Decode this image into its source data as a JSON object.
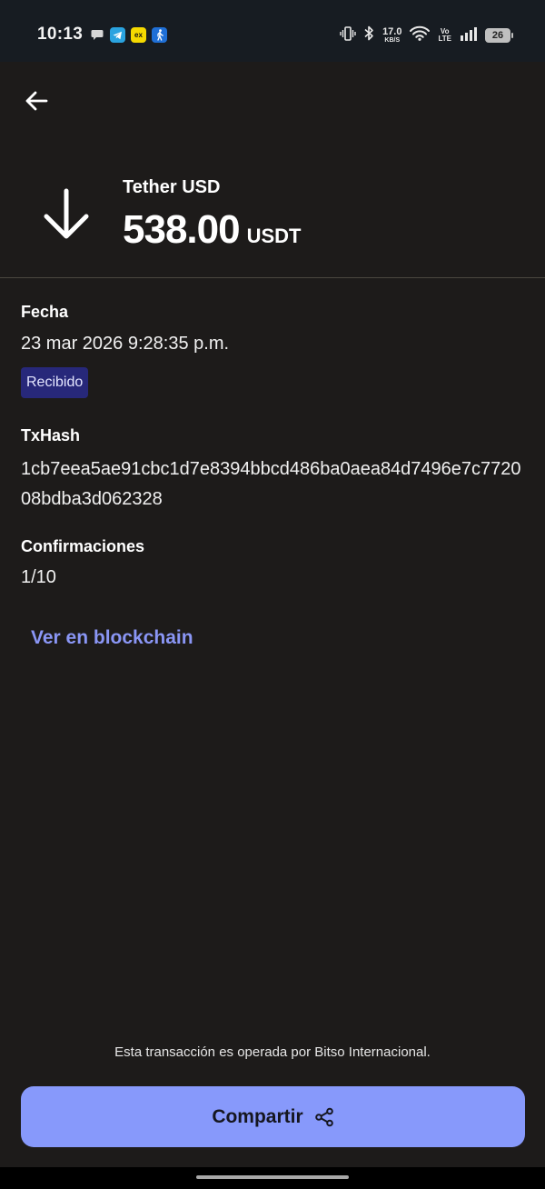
{
  "status_bar": {
    "time": "10:13",
    "net_speed_value": "17.0",
    "net_speed_unit": "KB/S",
    "volte_top": "Vo",
    "volte_bottom": "LTE",
    "battery": "26",
    "app_icons": [
      "chat-bubble-icon",
      "telegram-icon",
      "ex-app-icon",
      "walking-person-icon"
    ]
  },
  "header": {
    "back_icon": "arrow-left-icon",
    "direction_icon": "arrow-down-icon",
    "asset_name": "Tether USD",
    "amount": "538.00",
    "unit": "USDT"
  },
  "details": {
    "date_label": "Fecha",
    "date_value": "23 mar 2026 9:28:35 p.m.",
    "status_badge": "Recibido",
    "txhash_label": "TxHash",
    "txhash_value": "1cb7eea5ae91cbc1d7e8394bbcd486ba0aea84d7496e7c772008bdba3d062328",
    "confirmations_label": "Confirmaciones",
    "confirmations_value": "1/10",
    "blockchain_link": "Ver en blockchain"
  },
  "footer": {
    "note": "Esta transacción es operada por Bitso Internacional.",
    "share_label": "Compartir",
    "share_icon": "share-icon"
  },
  "colors": {
    "background": "#1d1b1a",
    "accent": "#8799fb",
    "link": "#8a96f5",
    "badge_bg": "#27287a"
  }
}
